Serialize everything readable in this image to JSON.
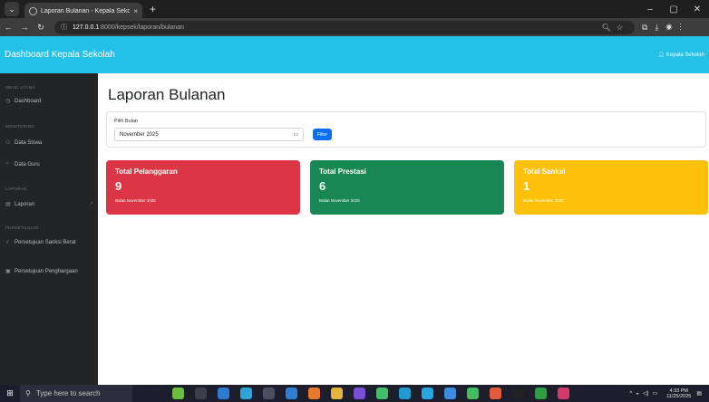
{
  "browser": {
    "tab_title": "Laporan Bulanan - Kepala Sekol",
    "tab_close": "×",
    "new_tab": "+",
    "url_host": "127.0.0.1",
    "url_path": ":8000/kepsek/laporan/bulanan",
    "window_controls": [
      "–",
      "▢",
      "✕"
    ]
  },
  "navbar": {
    "brand": "Dashboard Kepala Sekolah",
    "user": "Kepala Sekolah"
  },
  "sidebar": {
    "sections": [
      {
        "title": "MENU UTAMA",
        "items": [
          {
            "label": "Dashboard",
            "icon": "dashboard-icon"
          }
        ]
      },
      {
        "title": "MONITORING",
        "items": [
          {
            "label": "Data Siswa",
            "icon": "users-icon"
          },
          {
            "label": "Data Guru",
            "icon": "person-icon"
          }
        ]
      },
      {
        "title": "LAPORAN",
        "items": [
          {
            "label": "Laporan",
            "icon": "report-icon"
          }
        ]
      },
      {
        "title": "PERSETUJUAN",
        "items": [
          {
            "label": "Persetujuan Sanksi Berat",
            "icon": "check-icon"
          },
          {
            "label": "Persetujuan Penghargaan",
            "icon": "award-icon"
          }
        ]
      }
    ]
  },
  "main": {
    "title": "Laporan Bulanan",
    "filter": {
      "label": "Pilih Bulan",
      "value": "November 2025",
      "button": "Filter"
    },
    "cards": [
      {
        "title": "Total Pelanggaran",
        "value": "9",
        "subtitle": "Bulan November 2025",
        "color": "#dc3545"
      },
      {
        "title": "Total Prestasi",
        "value": "6",
        "subtitle": "Bulan November 2025",
        "color": "#198754"
      },
      {
        "title": "Total Sanksi",
        "value": "1",
        "subtitle": "Bulan November 2025",
        "color": "#ffc107"
      }
    ]
  },
  "taskbar": {
    "search_placeholder": "Type here to search",
    "time": "4:33 PM",
    "date": "11/25/2025"
  }
}
